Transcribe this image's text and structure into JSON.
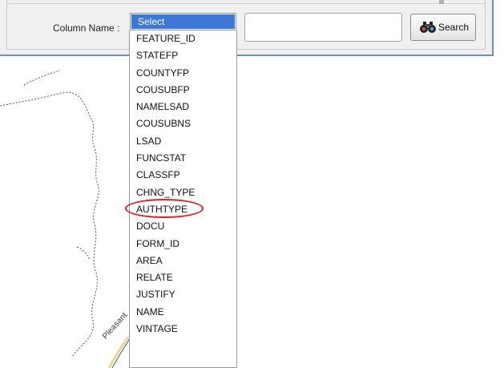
{
  "search_panel": {
    "column_label": "Column Name :",
    "selected_value": "Select",
    "search_text_value": "",
    "search_button_label": "Search",
    "search_button_icon": "binoculars-icon"
  },
  "dropdown": {
    "options": [
      "FEATURE_ID",
      "STATEFP",
      "COUNTYFP",
      "COUSUBFP",
      "NAMELSAD",
      "COUSUBNS",
      "LSAD",
      "FUNCSTAT",
      "CLASSFP",
      "CHNG_TYPE",
      "AUTHTYPE",
      "DOCU",
      "FORM_ID",
      "AREA",
      "RELATE",
      "JUSTIFY",
      "NAME",
      "VINTAGE"
    ],
    "highlighted_option": "CHNG_TYPE"
  },
  "map": {
    "road_label": "Pleasant"
  },
  "colors": {
    "selection_blue": "#3c78d8",
    "annotation_red": "#e02020",
    "panel_border": "#6f8fb5"
  }
}
